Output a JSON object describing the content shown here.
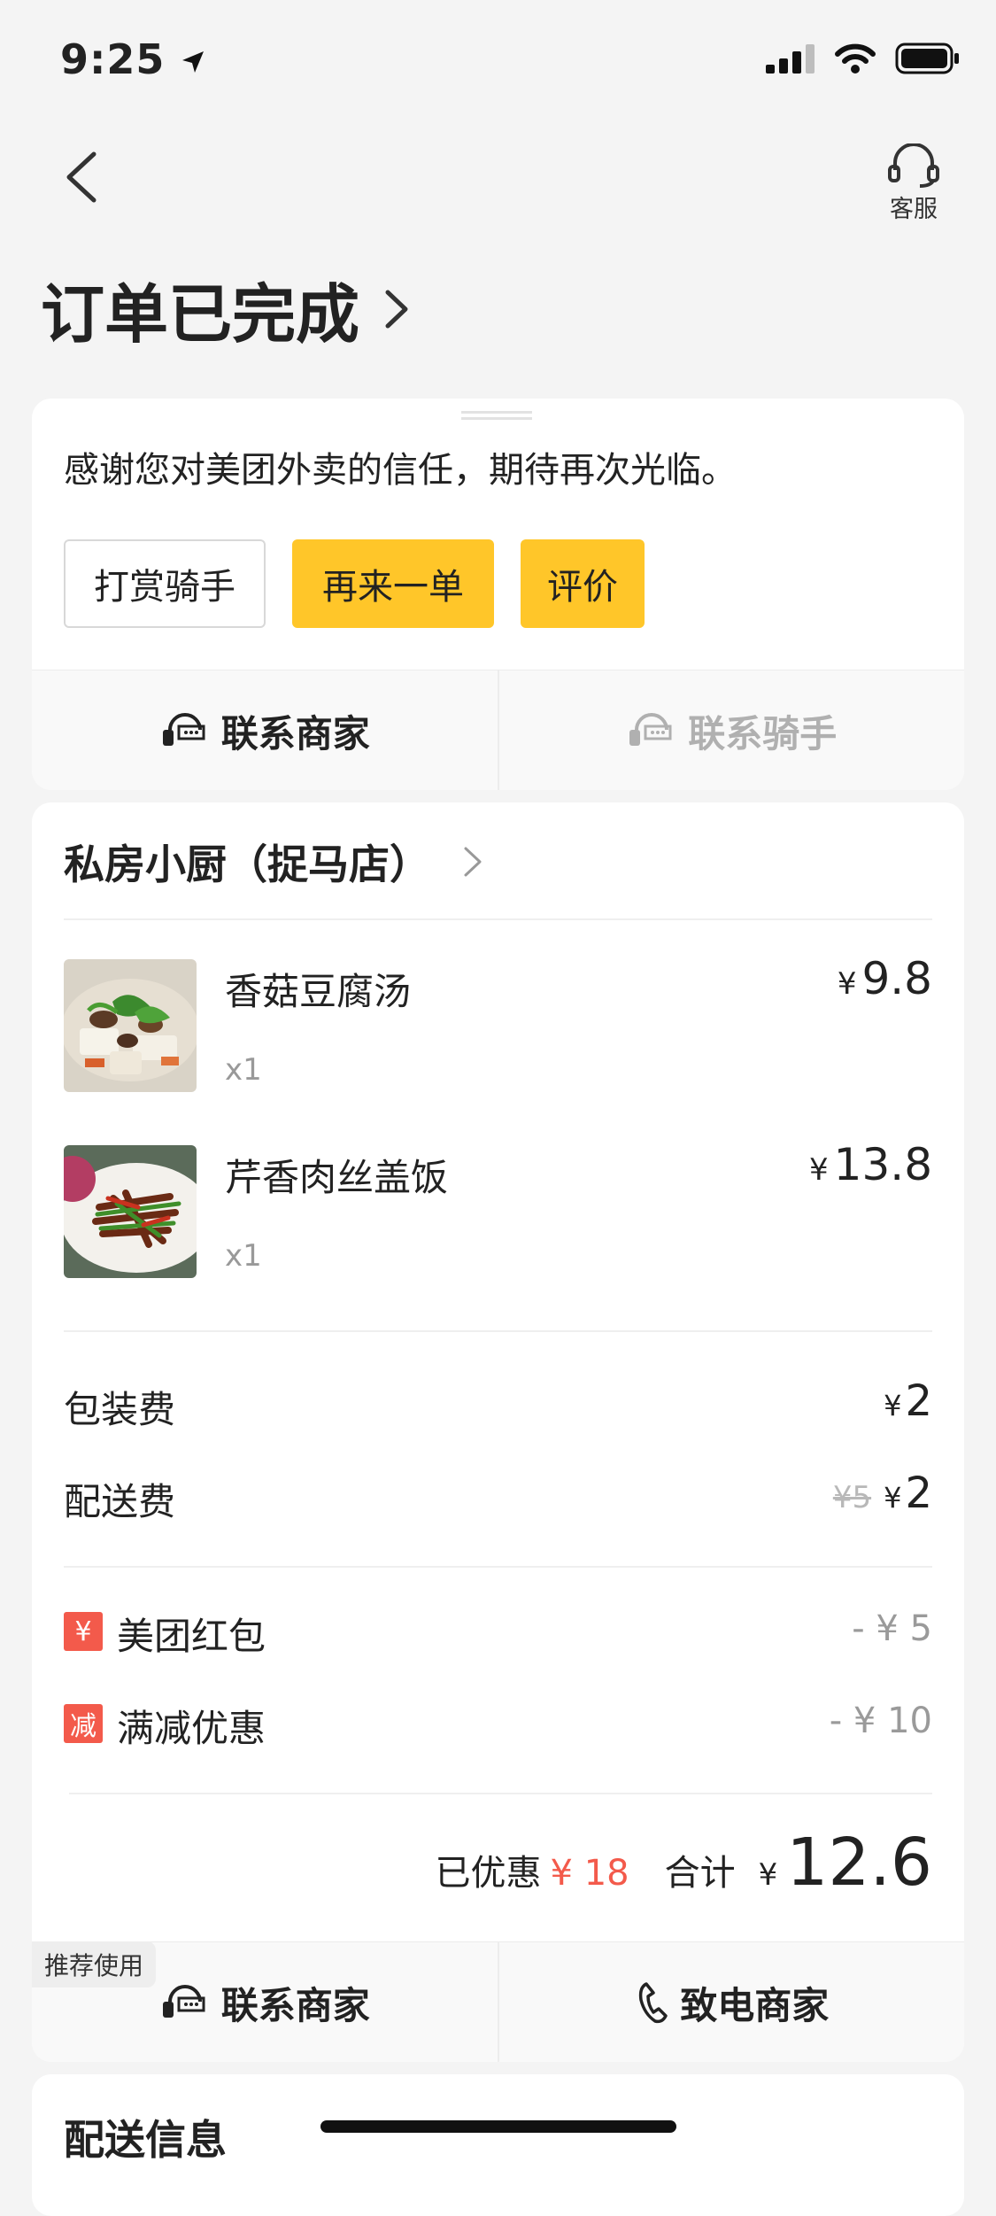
{
  "status_bar": {
    "time": "9:25"
  },
  "nav": {
    "service_label": "客服"
  },
  "title": "订单已完成",
  "thanks_card": {
    "message": "感谢您对美团外卖的信任，期待再次光临。",
    "buttons": {
      "tip": "打赏骑手",
      "reorder": "再来一单",
      "review": "评价"
    },
    "contact_merchant": "联系商家",
    "contact_rider": "联系骑手"
  },
  "order": {
    "shop_name": "私房小厨（捉马店）",
    "items": [
      {
        "name": "香菇豆腐汤",
        "qty": "x1",
        "currency": "¥",
        "price": "9.8"
      },
      {
        "name": "芹香肉丝盖饭",
        "qty": "x1",
        "currency": "¥",
        "price": "13.8"
      }
    ],
    "fees": {
      "packaging_label": "包装费",
      "packaging_value": "2",
      "delivery_label": "配送费",
      "delivery_original": "¥5",
      "delivery_value": "2",
      "currency": "¥"
    },
    "discounts": [
      {
        "badge": "¥",
        "label": "美团红包",
        "value": "- ¥ 5"
      },
      {
        "badge": "减",
        "label": "满减优惠",
        "value": "- ¥ 10"
      }
    ],
    "summary": {
      "saved_label": "已优惠",
      "saved_value": "¥ 18",
      "total_label": "合计",
      "currency": "¥",
      "total": "12.6"
    },
    "recommend_tag": "推荐使用",
    "contact_merchant": "联系商家",
    "call_merchant": "致电商家"
  },
  "delivery_section": {
    "title": "配送信息"
  },
  "colors": {
    "accent_yellow": "#ffc629",
    "discount_red": "#f35a4b"
  }
}
